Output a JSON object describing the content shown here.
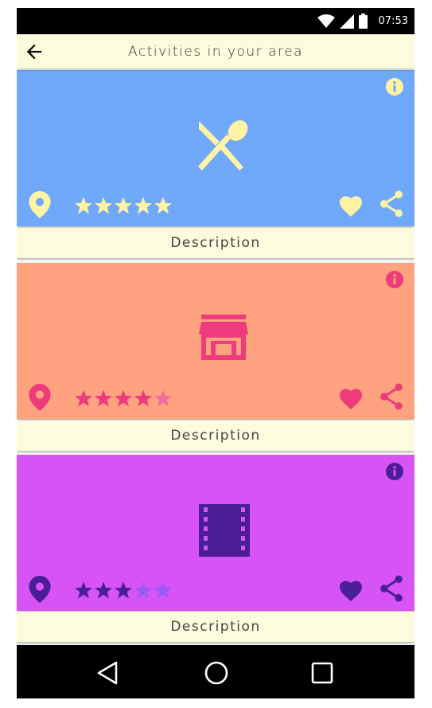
{
  "status_bar": {
    "time": "07:53",
    "icons": [
      "wifi-icon",
      "signal-icon",
      "battery-icon"
    ]
  },
  "app_bar": {
    "title": "Activities in your area",
    "back_icon": "arrow-back-icon"
  },
  "cards": [
    {
      "category_icon": "restaurant-icon",
      "background": "#70a8fb",
      "accent": "#fff4a3",
      "rating": 5,
      "rating_max": 5,
      "description_label": "Description"
    },
    {
      "category_icon": "store-icon",
      "background": "#ffa27f",
      "accent": "#ee3b7c",
      "rating": 4.5,
      "rating_max": 5,
      "description_label": "Description"
    },
    {
      "category_icon": "movie-film-icon",
      "background": "#d653f6",
      "accent": "#4b1d97",
      "rating": 3,
      "rating_max": 5,
      "description_label": "Description"
    }
  ],
  "nav_bar": {
    "buttons": [
      "back-triangle-icon",
      "home-circle-icon",
      "recents-square-icon"
    ]
  }
}
